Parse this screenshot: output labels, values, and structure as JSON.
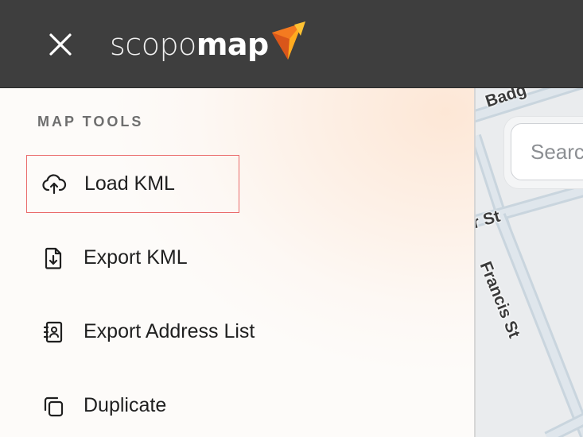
{
  "header": {
    "close_icon": "close-icon",
    "logo": {
      "light_part": "scopo",
      "bold_part": "map",
      "brand_color": "#f47a20",
      "accent_color": "#ffb020"
    }
  },
  "panel": {
    "section_title": "MAP TOOLS",
    "items": [
      {
        "label": "Load KML",
        "icon": "cloud-upload-icon",
        "focused": true
      },
      {
        "label": "Export KML",
        "icon": "file-download-icon",
        "focused": false
      },
      {
        "label": "Export Address List",
        "icon": "address-book-icon",
        "focused": false
      },
      {
        "label": "Duplicate",
        "icon": "duplicate-icon",
        "focused": false
      }
    ]
  },
  "map": {
    "search_placeholder": "Search",
    "streets": {
      "top": "Badg",
      "cross": "r St",
      "francis": "Francis St"
    }
  },
  "colors": {
    "header_bg": "#3e3e3e",
    "focus_outline": "#ea6b6b",
    "road": "#c9d5de"
  }
}
